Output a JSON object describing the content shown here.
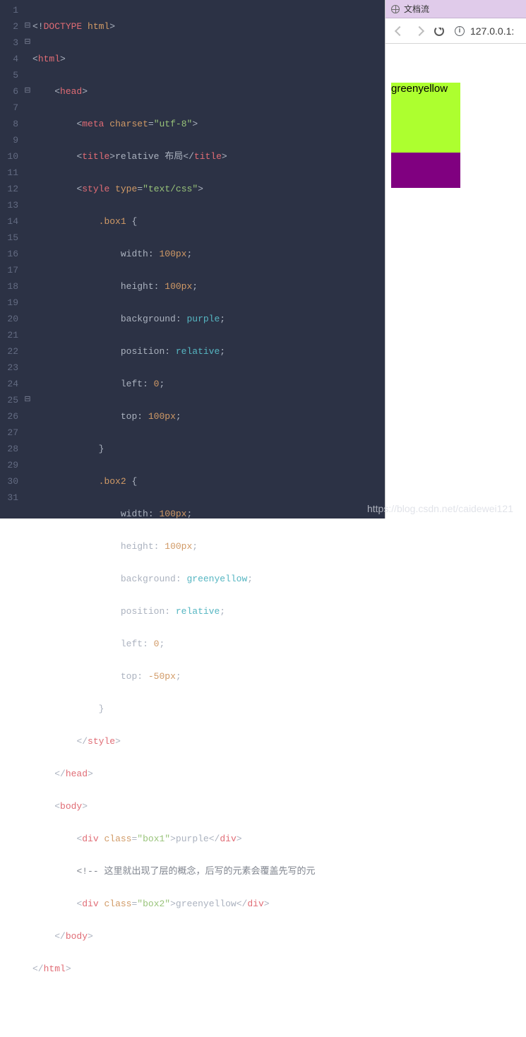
{
  "browser": {
    "tab_title": "文档流",
    "url_display": "127.0.0.1:",
    "info_glyph": "i"
  },
  "preview": {
    "green_label": "greenyellow"
  },
  "watermark": "https://blog.csdn.net/caidewei121",
  "code": {
    "lines": [
      "1",
      "2",
      "3",
      "4",
      "5",
      "6",
      "7",
      "8",
      "9",
      "10",
      "11",
      "12",
      "13",
      "14",
      "15",
      "16",
      "17",
      "18",
      "19",
      "20",
      "21",
      "22",
      "23",
      "24",
      "25",
      "26",
      "27",
      "28",
      "29",
      "30",
      "31"
    ],
    "folds": {
      "l2": "⊟",
      "l3": "⊟",
      "l6": "⊟",
      "l25": "⊟"
    },
    "l1": {
      "a": "<!",
      "b": "DOCTYPE",
      "c": " html",
      "d": ">"
    },
    "l2": {
      "a": "<",
      "b": "html",
      "c": ">"
    },
    "l3": {
      "a": "<",
      "b": "head",
      "c": ">"
    },
    "l4": {
      "a": "<",
      "b": "meta",
      "sp": " ",
      "attr": "charset",
      "eq": "=",
      "val": "\"utf-8\"",
      "c": ">"
    },
    "l5": {
      "a": "<",
      "b": "title",
      "c": ">",
      "txt": "relative 布局",
      "d": "</",
      "e": "title",
      "f": ">"
    },
    "l6": {
      "a": "<",
      "b": "style",
      "sp": " ",
      "attr": "type",
      "eq": "=",
      "val": "\"text/css\"",
      "c": ">"
    },
    "l7": {
      "sel": ".box1",
      "br": " {"
    },
    "l8": {
      "p": "width",
      "col": ": ",
      "v": "100px",
      "sc": ";"
    },
    "l9": {
      "p": "height",
      "col": ": ",
      "v": "100px",
      "sc": ";"
    },
    "l10": {
      "p": "background",
      "col": ": ",
      "v": "purple",
      "sc": ";"
    },
    "l11": {
      "p": "position",
      "col": ": ",
      "v": "relative",
      "sc": ";"
    },
    "l12": {
      "p": "left",
      "col": ": ",
      "v": "0",
      "sc": ";"
    },
    "l13": {
      "p": "top",
      "col": ": ",
      "v": "100px",
      "sc": ";"
    },
    "l14": {
      "br": "}"
    },
    "l15": {
      "sel": ".box2",
      "br": " {"
    },
    "l16": {
      "p": "width",
      "col": ": ",
      "v": "100px",
      "sc": ";"
    },
    "l17": {
      "p": "height",
      "col": ": ",
      "v": "100px",
      "sc": ";"
    },
    "l18": {
      "p": "background",
      "col": ": ",
      "v": "greenyellow",
      "sc": ";"
    },
    "l19": {
      "p": "position",
      "col": ": ",
      "v": "relative",
      "sc": ";"
    },
    "l20": {
      "p": "left",
      "col": ": ",
      "v": "0",
      "sc": ";"
    },
    "l21": {
      "p": "top",
      "col": ": ",
      "v": "-50px",
      "sc": ";"
    },
    "l22": {
      "br": "}"
    },
    "l23": {
      "a": "</",
      "b": "style",
      "c": ">"
    },
    "l24": {
      "a": "</",
      "b": "head",
      "c": ">"
    },
    "l25": {
      "a": "<",
      "b": "body",
      "c": ">"
    },
    "l26": {
      "a": "<",
      "b": "div",
      "sp": " ",
      "attr": "class",
      "eq": "=",
      "val": "\"box1\"",
      "c": ">",
      "txt": "purple",
      "d": "</",
      "e": "div",
      "f": ">"
    },
    "l27": {
      "c": "<!-- 这里就出现了层的概念，后写的元素会覆盖先写的元"
    },
    "l28": {
      "a": "<",
      "b": "div",
      "sp": " ",
      "attr": "class",
      "eq": "=",
      "val": "\"box2\"",
      "c": ">",
      "txt": "greenyellow",
      "d": "</",
      "e": "div",
      "f": ">"
    },
    "l29": {
      "a": "</",
      "b": "body",
      "c": ">"
    },
    "l30": {
      "a": "</",
      "b": "html",
      "c": ">"
    }
  }
}
